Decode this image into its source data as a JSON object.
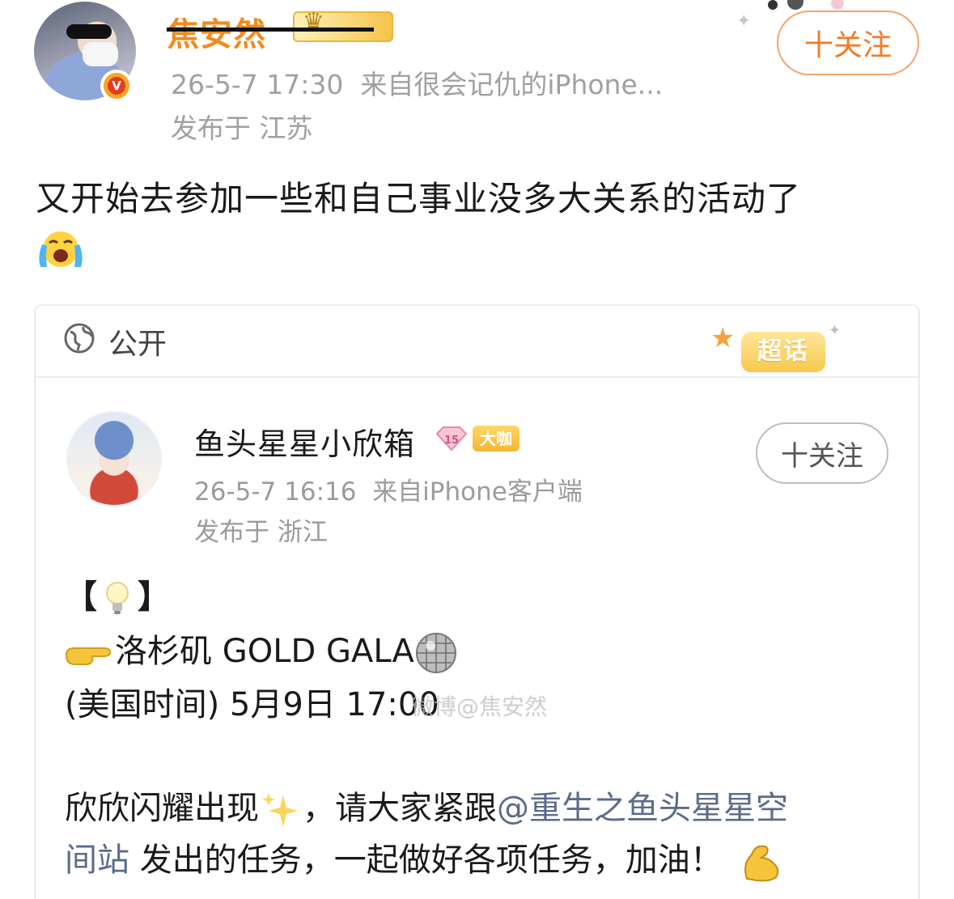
{
  "post": {
    "author": {
      "name": "焦安然"
    },
    "meta": {
      "time": "26-5-7 17:30",
      "source": "来自很会记仇的iPhone...",
      "location": "发布于 江苏"
    },
    "follow_label": "十关注",
    "text": "又开始去参加一些和自己事业没多大关系的活动了"
  },
  "card": {
    "visibility": "公开",
    "super_topic_label": "超话",
    "author": {
      "name": "鱼头星星小欣箱",
      "level": "15",
      "badge": "大咖"
    },
    "meta": {
      "time": "26-5-7 16:16",
      "source": "来自iPhone客户端",
      "location": "发布于 浙江"
    },
    "follow_label": "十关注",
    "lines": {
      "bracket_open": "【",
      "bracket_close": "】",
      "event": "洛杉矶 GOLD GALA",
      "time": "(美国时间) 5月9日 17:00",
      "body_1_pre": "欣欣闪耀出现",
      "body_1_post": "，请大家紧跟",
      "mention_1": "@重生之鱼头星星空",
      "mention_2": "间站",
      "body_2": "发出的任务，一起做好各项任务，加油！"
    },
    "watermark": "微博@焦安然"
  }
}
